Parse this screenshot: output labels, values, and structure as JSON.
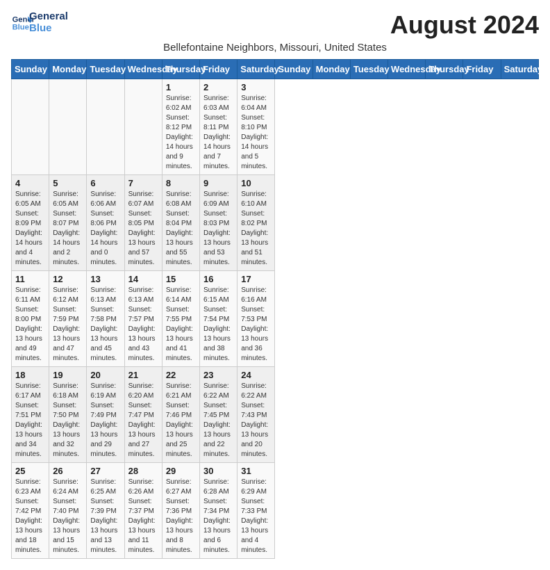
{
  "logo": {
    "line1": "General",
    "line2": "Blue"
  },
  "title": "August 2024",
  "subtitle": "Bellefontaine Neighbors, Missouri, United States",
  "days_of_week": [
    "Sunday",
    "Monday",
    "Tuesday",
    "Wednesday",
    "Thursday",
    "Friday",
    "Saturday"
  ],
  "weeks": [
    [
      {
        "day": "",
        "info": ""
      },
      {
        "day": "",
        "info": ""
      },
      {
        "day": "",
        "info": ""
      },
      {
        "day": "",
        "info": ""
      },
      {
        "day": "1",
        "info": "Sunrise: 6:02 AM\nSunset: 8:12 PM\nDaylight: 14 hours\nand 9 minutes."
      },
      {
        "day": "2",
        "info": "Sunrise: 6:03 AM\nSunset: 8:11 PM\nDaylight: 14 hours\nand 7 minutes."
      },
      {
        "day": "3",
        "info": "Sunrise: 6:04 AM\nSunset: 8:10 PM\nDaylight: 14 hours\nand 5 minutes."
      }
    ],
    [
      {
        "day": "4",
        "info": "Sunrise: 6:05 AM\nSunset: 8:09 PM\nDaylight: 14 hours\nand 4 minutes."
      },
      {
        "day": "5",
        "info": "Sunrise: 6:05 AM\nSunset: 8:07 PM\nDaylight: 14 hours\nand 2 minutes."
      },
      {
        "day": "6",
        "info": "Sunrise: 6:06 AM\nSunset: 8:06 PM\nDaylight: 14 hours\nand 0 minutes."
      },
      {
        "day": "7",
        "info": "Sunrise: 6:07 AM\nSunset: 8:05 PM\nDaylight: 13 hours\nand 57 minutes."
      },
      {
        "day": "8",
        "info": "Sunrise: 6:08 AM\nSunset: 8:04 PM\nDaylight: 13 hours\nand 55 minutes."
      },
      {
        "day": "9",
        "info": "Sunrise: 6:09 AM\nSunset: 8:03 PM\nDaylight: 13 hours\nand 53 minutes."
      },
      {
        "day": "10",
        "info": "Sunrise: 6:10 AM\nSunset: 8:02 PM\nDaylight: 13 hours\nand 51 minutes."
      }
    ],
    [
      {
        "day": "11",
        "info": "Sunrise: 6:11 AM\nSunset: 8:00 PM\nDaylight: 13 hours\nand 49 minutes."
      },
      {
        "day": "12",
        "info": "Sunrise: 6:12 AM\nSunset: 7:59 PM\nDaylight: 13 hours\nand 47 minutes."
      },
      {
        "day": "13",
        "info": "Sunrise: 6:13 AM\nSunset: 7:58 PM\nDaylight: 13 hours\nand 45 minutes."
      },
      {
        "day": "14",
        "info": "Sunrise: 6:13 AM\nSunset: 7:57 PM\nDaylight: 13 hours\nand 43 minutes."
      },
      {
        "day": "15",
        "info": "Sunrise: 6:14 AM\nSunset: 7:55 PM\nDaylight: 13 hours\nand 41 minutes."
      },
      {
        "day": "16",
        "info": "Sunrise: 6:15 AM\nSunset: 7:54 PM\nDaylight: 13 hours\nand 38 minutes."
      },
      {
        "day": "17",
        "info": "Sunrise: 6:16 AM\nSunset: 7:53 PM\nDaylight: 13 hours\nand 36 minutes."
      }
    ],
    [
      {
        "day": "18",
        "info": "Sunrise: 6:17 AM\nSunset: 7:51 PM\nDaylight: 13 hours\nand 34 minutes."
      },
      {
        "day": "19",
        "info": "Sunrise: 6:18 AM\nSunset: 7:50 PM\nDaylight: 13 hours\nand 32 minutes."
      },
      {
        "day": "20",
        "info": "Sunrise: 6:19 AM\nSunset: 7:49 PM\nDaylight: 13 hours\nand 29 minutes."
      },
      {
        "day": "21",
        "info": "Sunrise: 6:20 AM\nSunset: 7:47 PM\nDaylight: 13 hours\nand 27 minutes."
      },
      {
        "day": "22",
        "info": "Sunrise: 6:21 AM\nSunset: 7:46 PM\nDaylight: 13 hours\nand 25 minutes."
      },
      {
        "day": "23",
        "info": "Sunrise: 6:22 AM\nSunset: 7:45 PM\nDaylight: 13 hours\nand 22 minutes."
      },
      {
        "day": "24",
        "info": "Sunrise: 6:22 AM\nSunset: 7:43 PM\nDaylight: 13 hours\nand 20 minutes."
      }
    ],
    [
      {
        "day": "25",
        "info": "Sunrise: 6:23 AM\nSunset: 7:42 PM\nDaylight: 13 hours\nand 18 minutes."
      },
      {
        "day": "26",
        "info": "Sunrise: 6:24 AM\nSunset: 7:40 PM\nDaylight: 13 hours\nand 15 minutes."
      },
      {
        "day": "27",
        "info": "Sunrise: 6:25 AM\nSunset: 7:39 PM\nDaylight: 13 hours\nand 13 minutes."
      },
      {
        "day": "28",
        "info": "Sunrise: 6:26 AM\nSunset: 7:37 PM\nDaylight: 13 hours\nand 11 minutes."
      },
      {
        "day": "29",
        "info": "Sunrise: 6:27 AM\nSunset: 7:36 PM\nDaylight: 13 hours\nand 8 minutes."
      },
      {
        "day": "30",
        "info": "Sunrise: 6:28 AM\nSunset: 7:34 PM\nDaylight: 13 hours\nand 6 minutes."
      },
      {
        "day": "31",
        "info": "Sunrise: 6:29 AM\nSunset: 7:33 PM\nDaylight: 13 hours\nand 4 minutes."
      }
    ]
  ]
}
